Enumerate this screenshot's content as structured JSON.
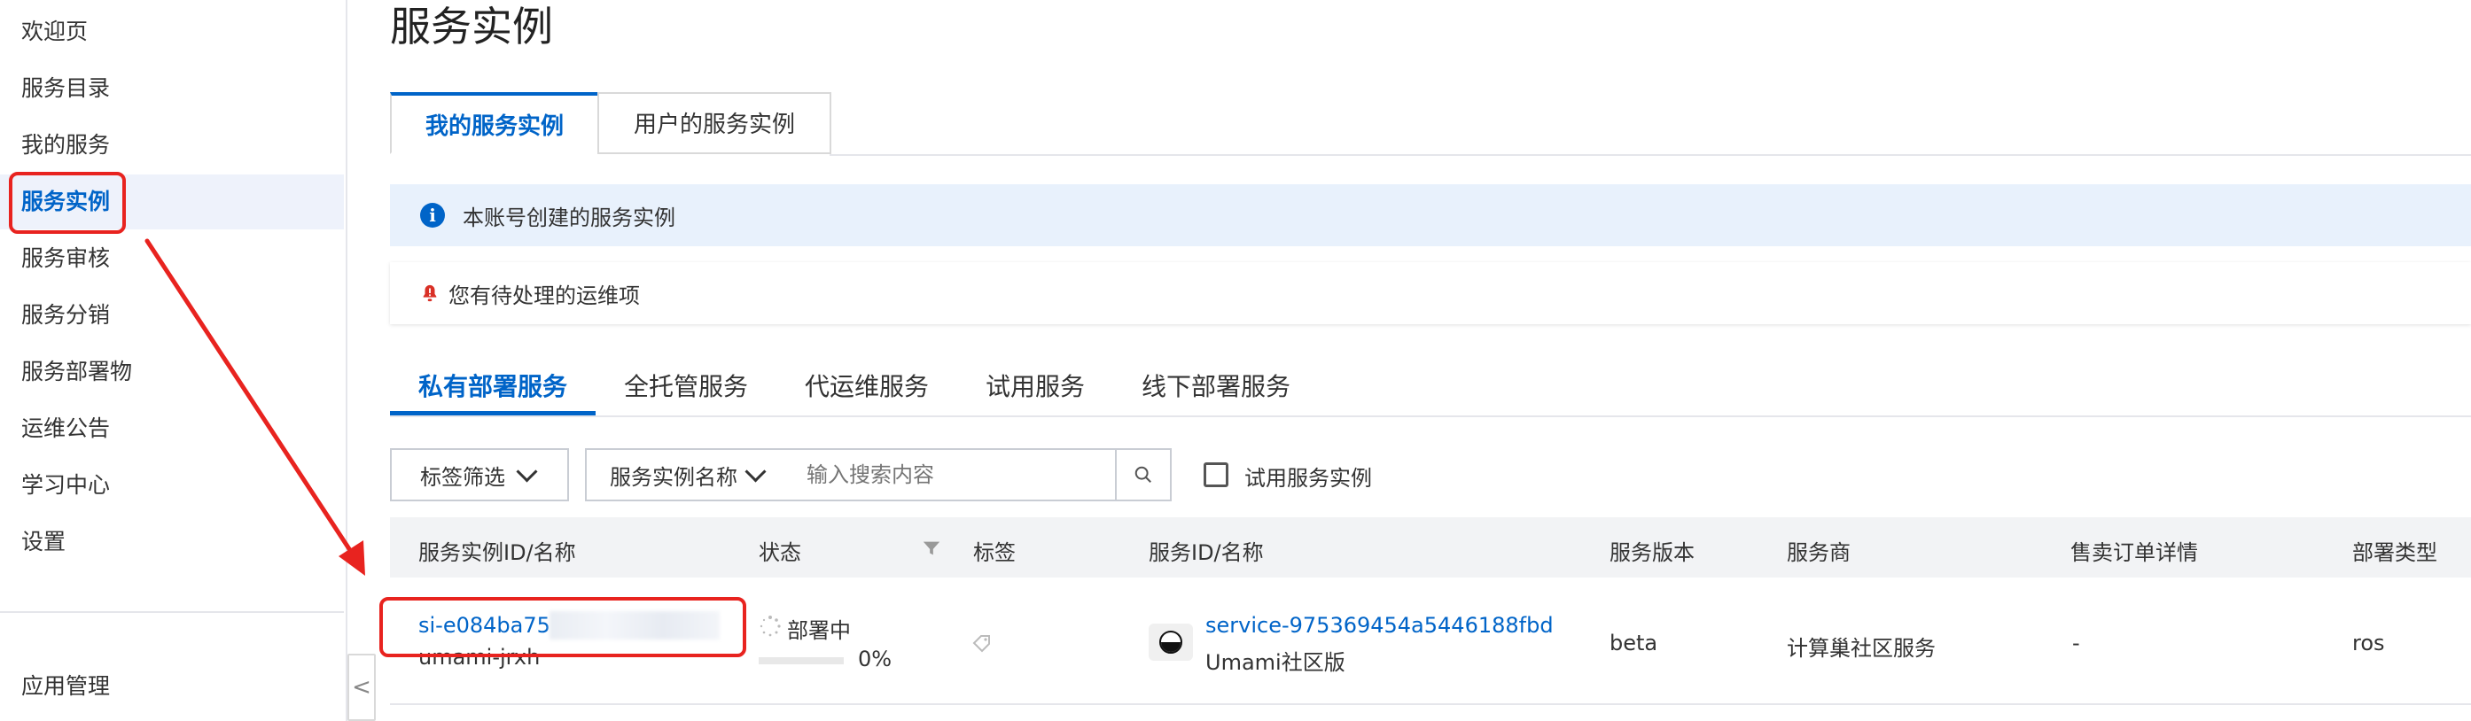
{
  "sidebar": {
    "items": [
      {
        "label": "欢迎页"
      },
      {
        "label": "服务目录"
      },
      {
        "label": "我的服务"
      },
      {
        "label": "服务实例"
      },
      {
        "label": "服务审核"
      },
      {
        "label": "服务分销"
      },
      {
        "label": "服务部署物"
      },
      {
        "label": "运维公告"
      },
      {
        "label": "学习中心"
      },
      {
        "label": "设置"
      }
    ],
    "bottom_item": "应用管理",
    "collapse_glyph": "<"
  },
  "page": {
    "title": "服务实例",
    "top_tabs": [
      {
        "label": "我的服务实例"
      },
      {
        "label": "用户的服务实例"
      }
    ],
    "info_message": "本账号创建的服务实例",
    "alert_message": "您有待处理的运维项",
    "sub_tabs": [
      {
        "label": "私有部署服务"
      },
      {
        "label": "全托管服务"
      },
      {
        "label": "代运维服务"
      },
      {
        "label": "试用服务"
      },
      {
        "label": "线下部署服务"
      }
    ]
  },
  "filters": {
    "tag_filter": "标签筛选",
    "field_select": "服务实例名称",
    "search_placeholder": "输入搜索内容",
    "trial_checkbox_label": "试用服务实例"
  },
  "table": {
    "columns": [
      "服务实例ID/名称",
      "状态",
      "标签",
      "服务ID/名称",
      "服务版本",
      "服务商",
      "售卖订单详情",
      "部署类型"
    ],
    "rows": [
      {
        "instance_id": "si-e084ba75",
        "instance_name": "umami-jrxh",
        "status": "部署中",
        "progress_text": "0%",
        "progress": 0,
        "service_id": "service-975369454a5446188fbd",
        "service_name": "Umami社区版",
        "version": "beta",
        "provider": "计算巢社区服务",
        "order": "-",
        "deploy_type": "ros"
      }
    ]
  },
  "icons": {
    "info": "info-icon",
    "alert": "bell-icon",
    "search": "search-icon",
    "filter": "filter-icon",
    "tag": "tag-icon",
    "spinner": "loading-icon",
    "service": "service-logo-icon"
  },
  "colors": {
    "accent": "#0064c8",
    "annotation": "#e8231f",
    "info_bg": "#e8f1fc"
  }
}
